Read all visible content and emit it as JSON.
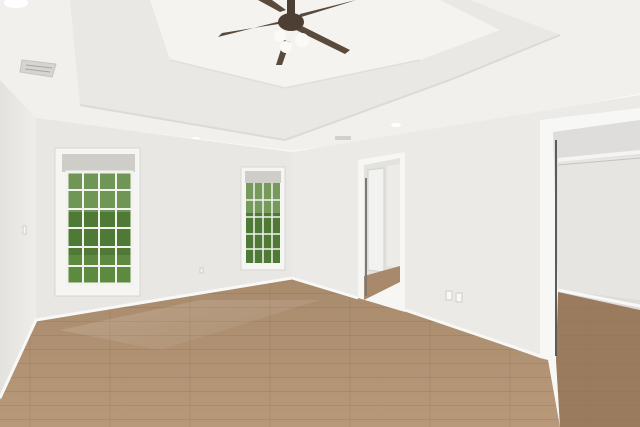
{
  "scene": {
    "photo_type": "empty bedroom interior",
    "colors": {
      "ceiling": "#f2f1ee",
      "tray_ceiling": "#ecebe7",
      "wall_left": "#eeedea",
      "wall_back": "#e6e5e1",
      "wall_right": "#ebeae6",
      "trim": "#f7f7f5",
      "floor_light": "#b89a7b",
      "floor_dark": "#8d6f53",
      "fan_blade": "#5a4a3c",
      "greenery": "#4f7a35",
      "closet_interior": "#dcdcda"
    }
  }
}
